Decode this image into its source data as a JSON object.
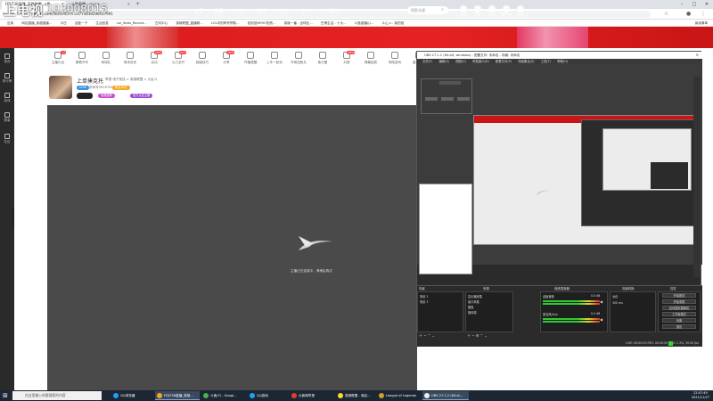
{
  "browser": {
    "tabs": [
      {
        "label": "FDLT36直播_英雄联盟_斗鱼...",
        "active": true
      },
      {
        "label": "斗鱼直播 - 斗山 x ...",
        "active": false
      }
    ],
    "url": "douyu.com/5616781?rr=3771810200517991",
    "bookmarks": [
      "应用",
      "网站直播_英超直播...",
      "今日",
      "百度一下",
      "生活信息",
      "Lol_Stats_Record...",
      "古河中心",
      "英雄联盟_直播精...",
      "LOL中的称号赞助...",
      "炫彩回HERO的资...",
      "英雄一番 - 全球比...",
      "巴博生活 - 十大...",
      "斗鱼直播(J)...",
      "斗山 x - 我的首",
      "阅读清单"
    ]
  },
  "douyu": {
    "logo": "上电视",
    "watermark": "103008015",
    "nav": [
      "首页",
      "直播",
      "分类",
      "视频",
      "游戏",
      "鱼吧",
      "有证福利"
    ],
    "search_placeholder": "搜索关键",
    "top_icons": [
      "充值",
      "历史",
      "开播",
      "客户端",
      "消息"
    ]
  },
  "sidebar": [
    "首页",
    "排行榜",
    "游戏",
    "赛事",
    "社区"
  ],
  "toolbar": [
    {
      "label": "主播礼包",
      "badge": "12"
    },
    {
      "label": "看看开车",
      "badge": ""
    },
    {
      "label": "网络礼",
      "badge": ""
    },
    {
      "label": "周末狂欢",
      "badge": ""
    },
    {
      "label": "活动",
      "badge": "NEW"
    },
    {
      "label": "火力全开",
      "badge": "HOT"
    },
    {
      "label": "超级技巧",
      "badge": ""
    },
    {
      "label": "分享",
      "badge": "NEW"
    },
    {
      "label": "开播提醒",
      "badge": ""
    },
    {
      "label": "上车一起玩",
      "badge": ""
    },
    {
      "label": "开局送鱼丸",
      "badge": ""
    },
    {
      "label": "鱼乐盟",
      "badge": ""
    },
    {
      "label": "抖音",
      "badge": "NEW"
    },
    {
      "label": "弹幕抽奖",
      "badge": ""
    },
    {
      "label": "网络游戏",
      "badge": ""
    },
    {
      "label": "直播反馈",
      "badge": ""
    }
  ],
  "anchor": {
    "name": "上单揍克托",
    "meta": "举报  电子竞技 > 英雄联盟 > 大乱斗",
    "level": "LV36",
    "room": "房间号5616781",
    "followers": "粉丝18万",
    "tag1": "电竞超神",
    "tag2": "官方认证主播"
  },
  "player": {
    "loading_text": "主播正在连接中，请稍后再试"
  },
  "obs": {
    "title": "OBS 27.1.2 (64-bit, windows) - 配置文件: 未命名 - 场景: 未命名",
    "menu": [
      "文件(F)",
      "编辑(E)",
      "视图(V)",
      "停靠窗口(D)",
      "配置文件(P)",
      "场景集合(S)",
      "工具(T)",
      "帮助(H)"
    ],
    "docks": [
      "场景",
      "来源",
      "音频混音器",
      "场景转换",
      "控件"
    ],
    "scenes": [
      "场景 2",
      "场景 3"
    ],
    "sources": [
      "显示器采集",
      "窗口采集",
      "图像",
      "媒体源"
    ],
    "mixer": [
      {
        "name": "桌面音频",
        "level": "0.0 dB"
      },
      {
        "name": "麦克风/Aux",
        "level": "0.0 dB"
      }
    ],
    "transition": {
      "type": "淡化",
      "duration": "300 ms"
    },
    "controls": [
      "开始推流",
      "开始录制",
      "启动虚拟摄像机",
      "工作室模式",
      "设置",
      "退出"
    ],
    "status": "LIVE: 00:00:00   REC: 00:00:00   CPU: 2.3%, 30.00 fps"
  },
  "taskbar": {
    "search": "在这里输入你要搜索的内容",
    "apps": [
      "QQ浏览器",
      "FDLT36直播_英雄...",
      "斗鱼(F) - Googl...",
      "QQ游戏",
      "大新闻早报",
      "英雄联盟 - 商店...",
      "League of Legends",
      "OBS 27.1.2 (64-bi..."
    ],
    "time": "22:07:49",
    "date": "2021/11/27"
  }
}
